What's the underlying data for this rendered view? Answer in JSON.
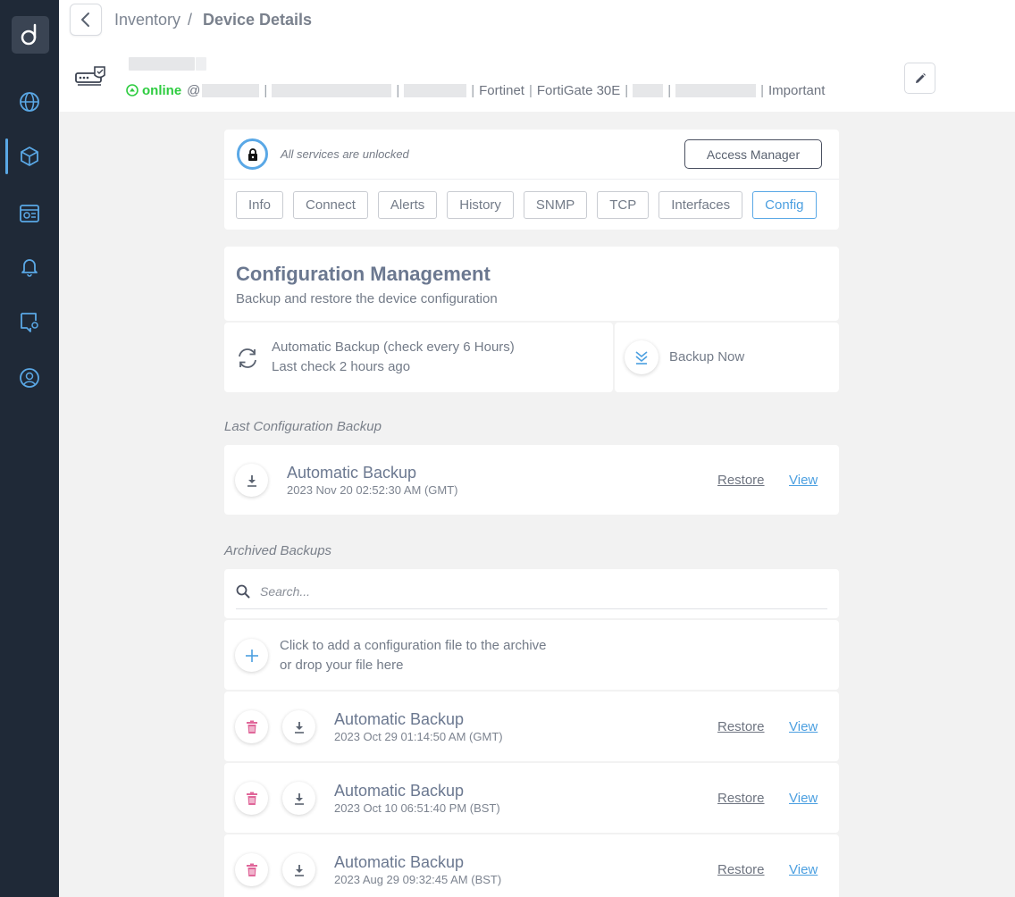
{
  "breadcrumb": {
    "parent": "Inventory",
    "separator": "/",
    "current": "Device Details"
  },
  "device": {
    "status": "online",
    "at_symbol": "@",
    "vendor": "Fortinet",
    "model": "FortiGate 30E",
    "priority": "Important",
    "status_color": "#2ecc40"
  },
  "access": {
    "message": "All services are unlocked",
    "button_label": "Access Manager"
  },
  "tabs": [
    {
      "label": "Info"
    },
    {
      "label": "Connect"
    },
    {
      "label": "Alerts"
    },
    {
      "label": "History"
    },
    {
      "label": "SNMP"
    },
    {
      "label": "TCP"
    },
    {
      "label": "Interfaces"
    },
    {
      "label": "Config",
      "active": true
    }
  ],
  "config": {
    "title": "Configuration Management",
    "subtitle": "Backup and restore the device configuration",
    "auto_backup": "Automatic Backup (check every 6 Hours)",
    "last_check": "Last check 2 hours ago",
    "backup_now": "Backup Now"
  },
  "last_backup": {
    "section_label": "Last Configuration Backup",
    "name": "Automatic Backup",
    "date": "2023 Nov 20 02:52:30 AM (GMT)",
    "restore": "Restore",
    "view": "View"
  },
  "archived": {
    "section_label": "Archived Backups",
    "search_placeholder": "Search...",
    "add_line1": "Click to add a configuration file to the archive",
    "add_line2": "or drop your file here",
    "items": [
      {
        "name": "Automatic Backup",
        "date": "2023 Oct 29 01:14:50 AM (GMT)",
        "restore": "Restore",
        "view": "View"
      },
      {
        "name": "Automatic Backup",
        "date": "2023 Oct 10 06:51:40 PM (BST)",
        "restore": "Restore",
        "view": "View"
      },
      {
        "name": "Automatic Backup",
        "date": "2023 Aug 29 09:32:45 AM (BST)",
        "restore": "Restore",
        "view": "View"
      }
    ]
  },
  "sidebar": {
    "items": [
      {
        "icon": "globe-icon"
      },
      {
        "icon": "cube-icon",
        "active": true
      },
      {
        "icon": "dashboard-icon"
      },
      {
        "icon": "bell-icon"
      },
      {
        "icon": "map-icon"
      },
      {
        "icon": "support-icon"
      }
    ]
  },
  "colors": {
    "accent": "#4b9fe0",
    "sidebar": "#1f2937",
    "delete": "#e0679a"
  }
}
